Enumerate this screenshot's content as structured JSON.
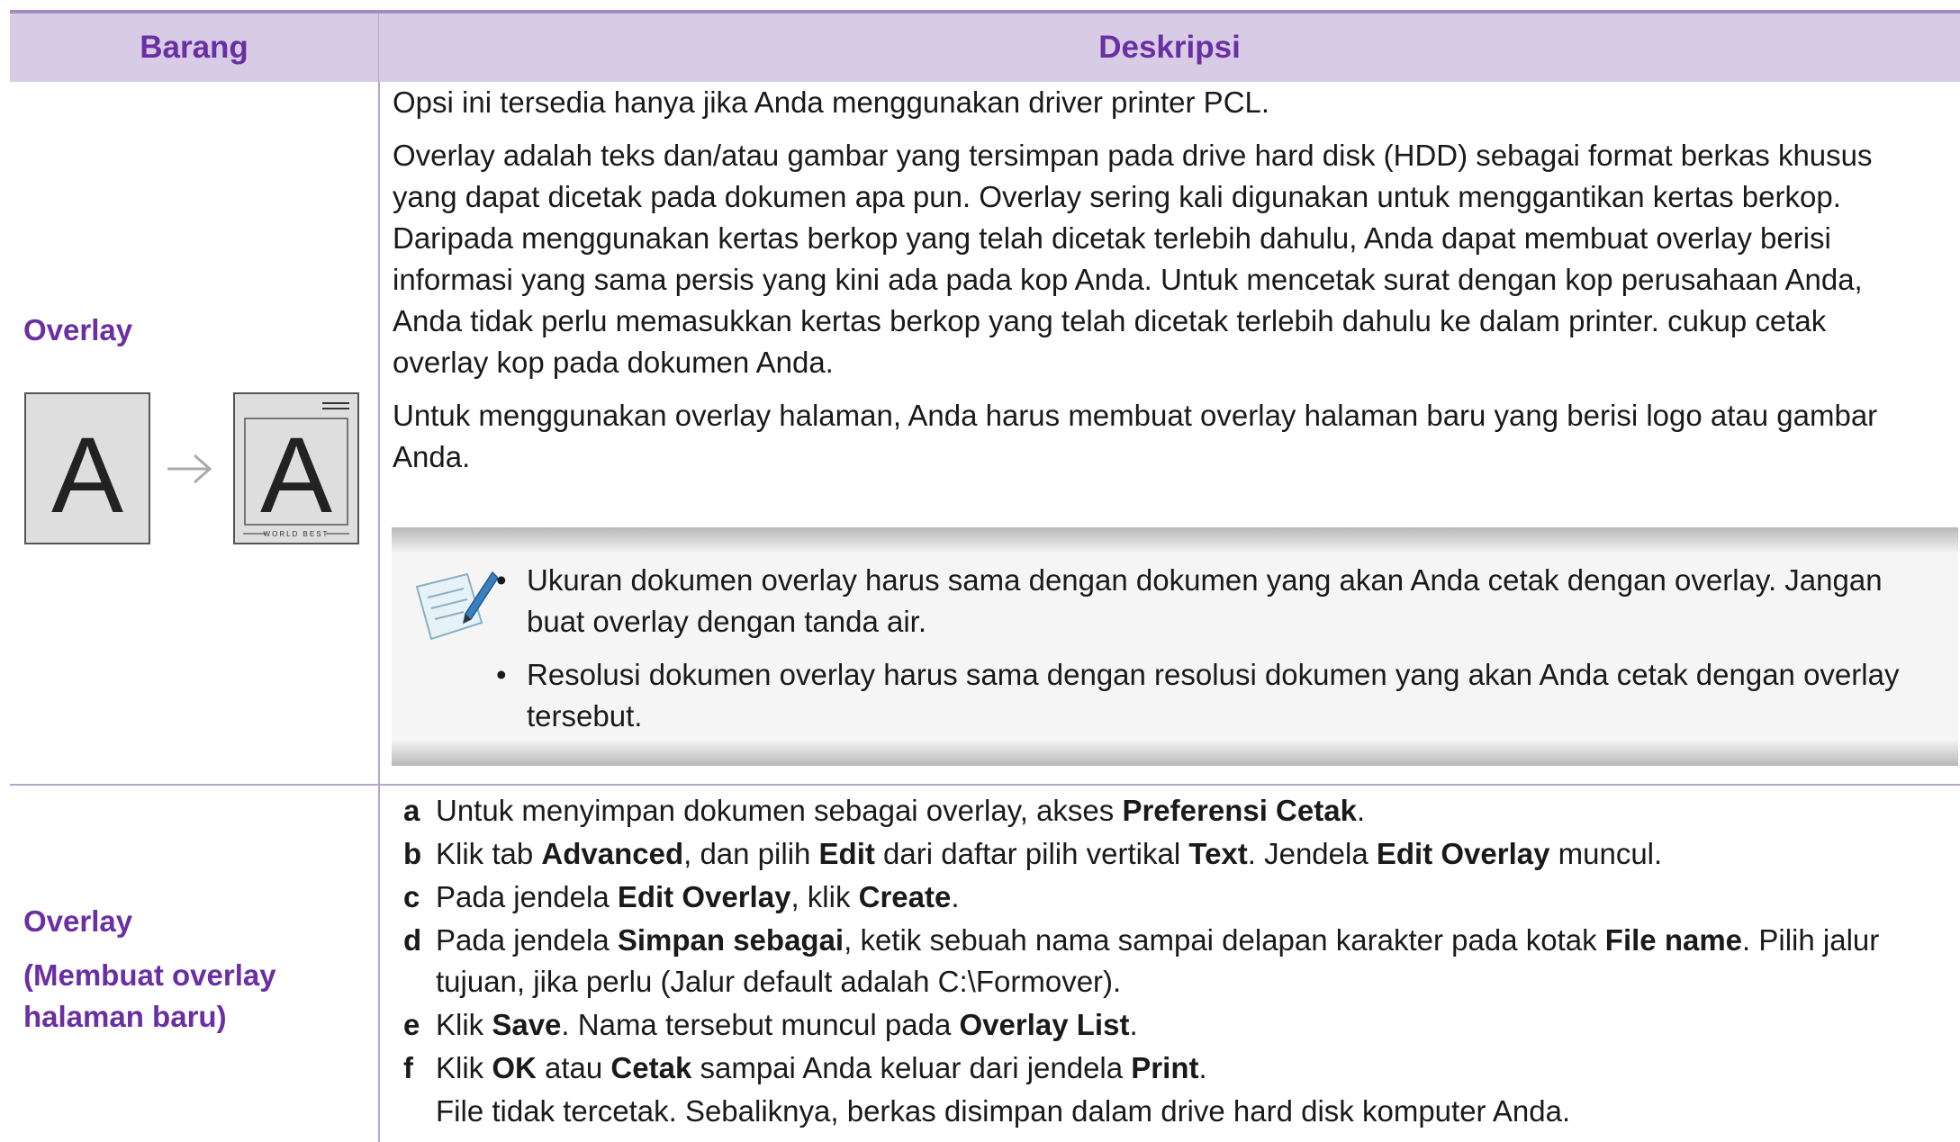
{
  "header": {
    "col1": "Barang",
    "col2": "Deskripsi"
  },
  "row1": {
    "item": "Overlay",
    "illustration": {
      "letter_left": "A",
      "letter_right": "A",
      "footer_text": "WORLD BEST"
    },
    "paragraphs": [
      "Opsi ini tersedia hanya jika Anda menggunakan driver printer PCL.",
      "Overlay adalah teks dan/atau gambar yang tersimpan pada drive hard disk (HDD) sebagai format berkas khusus yang dapat dicetak pada dokumen apa pun. Overlay sering kali digunakan untuk menggantikan kertas berkop. Daripada menggunakan kertas berkop yang telah dicetak terlebih dahulu, Anda dapat membuat overlay berisi informasi yang sama persis yang kini ada pada kop Anda. Untuk mencetak surat dengan kop perusahaan Anda, Anda tidak perlu memasukkan kertas berkop yang telah dicetak terlebih dahulu ke dalam printer. cukup cetak overlay kop pada dokumen Anda.",
      "Untuk menggunakan overlay halaman, Anda harus membuat overlay halaman baru yang berisi logo atau gambar Anda."
    ],
    "note": {
      "bullet": "•",
      "items": [
        "Ukuran dokumen overlay harus sama dengan dokumen yang akan Anda cetak dengan overlay. Jangan buat overlay dengan tanda air.",
        "Resolusi dokumen overlay harus sama dengan resolusi dokumen yang akan Anda cetak dengan overlay tersebut."
      ]
    }
  },
  "row2": {
    "item_title": "Overlay",
    "item_subtitle_line1": "(Membuat overlay",
    "item_subtitle_line2": "halaman baru)",
    "steps": [
      {
        "letter": "a",
        "parts": [
          {
            "t": "Untuk menyimpan dokumen sebagai overlay, akses "
          },
          {
            "t": "Preferensi Cetak",
            "b": true
          },
          {
            "t": "."
          }
        ]
      },
      {
        "letter": "b",
        "parts": [
          {
            "t": "Klik tab "
          },
          {
            "t": "Advanced",
            "b": true
          },
          {
            "t": ", dan pilih "
          },
          {
            "t": "Edit",
            "b": true
          },
          {
            "t": " dari daftar pilih vertikal "
          },
          {
            "t": "Text",
            "b": true
          },
          {
            "t": ". Jendela "
          },
          {
            "t": "Edit Overlay",
            "b": true
          },
          {
            "t": " muncul."
          }
        ]
      },
      {
        "letter": "c",
        "parts": [
          {
            "t": "Pada jendela "
          },
          {
            "t": "Edit Overlay",
            "b": true
          },
          {
            "t": ", klik "
          },
          {
            "t": "Create",
            "b": true
          },
          {
            "t": "."
          }
        ]
      },
      {
        "letter": "d",
        "parts": [
          {
            "t": "Pada jendela "
          },
          {
            "t": "Simpan sebagai",
            "b": true
          },
          {
            "t": ", ketik sebuah nama sampai delapan karakter pada kotak "
          },
          {
            "t": "File name",
            "b": true
          },
          {
            "t": ". Pilih jalur tujuan, jika perlu (Jalur default adalah C:\\Formover)."
          }
        ]
      },
      {
        "letter": "e",
        "parts": [
          {
            "t": "Klik "
          },
          {
            "t": "Save",
            "b": true
          },
          {
            "t": ". Nama tersebut muncul pada "
          },
          {
            "t": "Overlay List",
            "b": true
          },
          {
            "t": "."
          }
        ]
      },
      {
        "letter": "f",
        "parts": [
          {
            "t": "Klik "
          },
          {
            "t": "OK",
            "b": true
          },
          {
            "t": " atau "
          },
          {
            "t": "Cetak",
            "b": true
          },
          {
            "t": " sampai Anda keluar dari jendela "
          },
          {
            "t": "Print",
            "b": true
          },
          {
            "t": "."
          }
        ]
      }
    ],
    "final_note": "File tidak tercetak. Sebaliknya, berkas disimpan dalam drive hard disk komputer Anda."
  }
}
